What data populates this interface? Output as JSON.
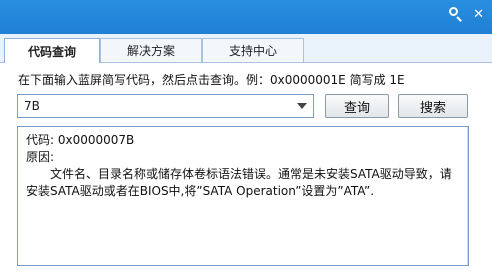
{
  "header": {
    "icons": [
      "search-icon",
      "close-icon"
    ]
  },
  "tabs": [
    {
      "label": "代码查询",
      "active": true
    },
    {
      "label": "解决方案",
      "active": false
    },
    {
      "label": "支持中心",
      "active": false
    }
  ],
  "query": {
    "instruction": "在下面输入蓝屏简写代码，然后点击查询。例：0x0000001E 简写成 1E",
    "code_value": "7B",
    "query_button": "查询",
    "search_button": "搜索"
  },
  "result": {
    "code_line": "代码: 0x0000007B",
    "reason_label": "原因:",
    "reason_text": "文件名、目录名称或储存体卷标语法错误。通常是未安装SATA驱动导致，请安装SATA驱动或者在BIOS中,将”SATA Operation”设置为”ATA”."
  },
  "colors": {
    "titlebar": "#1f7fd4",
    "tab_border": "#a9c3de",
    "field_border": "#7a9cc6"
  }
}
